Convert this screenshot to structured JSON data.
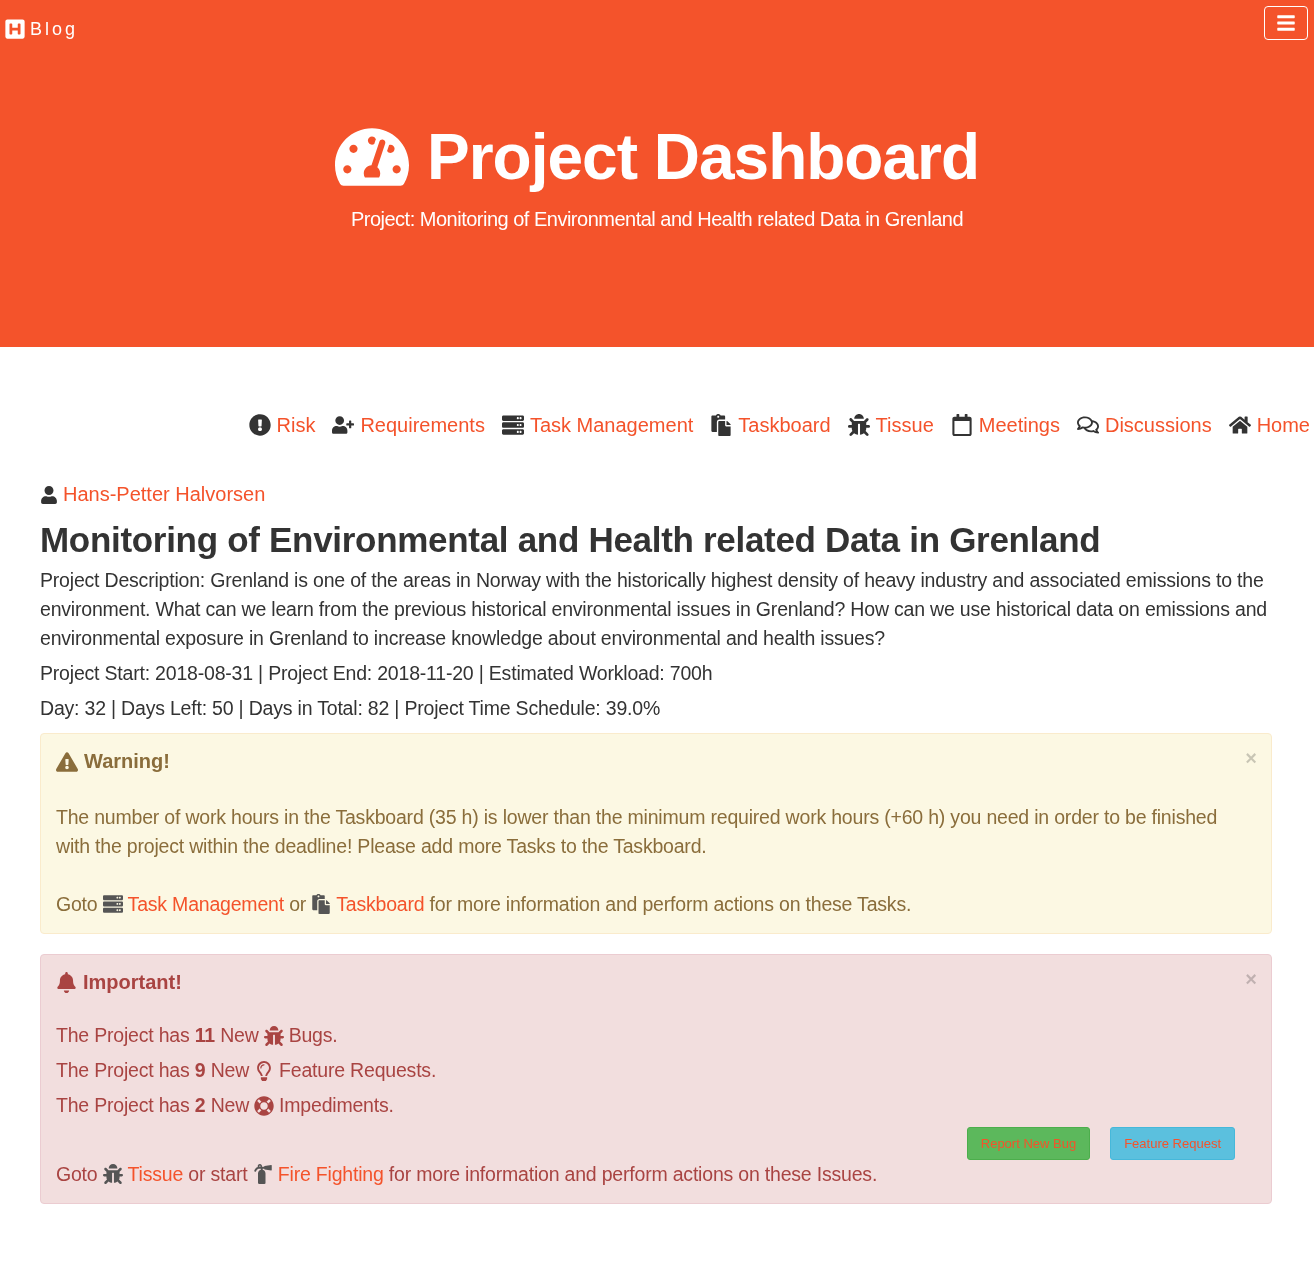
{
  "navbar": {
    "brand": "Blog"
  },
  "header": {
    "title": "Project Dashboard",
    "subtitle": "Project: Monitoring of Environmental and Health related Data in Grenland"
  },
  "nav_links": [
    {
      "label": "Risk"
    },
    {
      "label": "Requirements"
    },
    {
      "label": "Task Management"
    },
    {
      "label": "Taskboard"
    },
    {
      "label": "Tissue"
    },
    {
      "label": "Meetings"
    },
    {
      "label": "Discussions"
    },
    {
      "label": "Home"
    }
  ],
  "author": "Hans-Petter Halvorsen",
  "project": {
    "title": "Monitoring of Environmental and Health related Data in Grenland",
    "description": "Project Description: Grenland is one of the areas in Norway with the historically highest density of heavy industry and associated emissions to the environment. What can we learn from the previous historical environmental issues in Grenland? How can we use historical data on emissions and environmental exposure in Grenland to increase knowledge about environmental and health issues?",
    "dates": "Project Start: 2018-08-31 | Project End: 2018-11-20 | Estimated Workload: 700h",
    "schedule": "Day: 32 | Days Left: 50 | Days in Total: 82 | Project Time Schedule: 39.0%"
  },
  "warning": {
    "title": "Warning!",
    "close": "×",
    "message": "The number of work hours in the Taskboard (35 h) is lower than the minimum required work hours (+60 h) you need in order to be finished with the project within the deadline! Please add more Tasks to the Taskboard.",
    "goto": [
      {
        "kind": "text",
        "text": "Goto"
      },
      {
        "kind": "link",
        "text": "Task Management"
      },
      {
        "kind": "text",
        "text": "or"
      },
      {
        "kind": "link",
        "text": "Taskboard"
      },
      {
        "kind": "text",
        "text": "for more information and perform actions on these Tasks."
      }
    ]
  },
  "important": {
    "title": "Important!",
    "close": "×",
    "lines": [
      {
        "before": "The Project has **11** New",
        "after": "Bugs."
      },
      {
        "before": "The Project has **9** New",
        "after": "Feature Requests."
      },
      {
        "before": "The Project has **2** New",
        "after": "Impediments."
      }
    ],
    "buttons": [
      {
        "label": "Report New Bug",
        "kind": "success"
      },
      {
        "label": "Feature Request",
        "kind": "info"
      }
    ],
    "goto": [
      {
        "kind": "text",
        "text": "Goto"
      },
      {
        "kind": "link",
        "text": "Tissue"
      },
      {
        "kind": "text",
        "text": "or start"
      },
      {
        "kind": "link",
        "text": "Fire Fighting"
      },
      {
        "kind": "text",
        "text": "for more information and perform actions on these Issues."
      }
    ]
  }
}
